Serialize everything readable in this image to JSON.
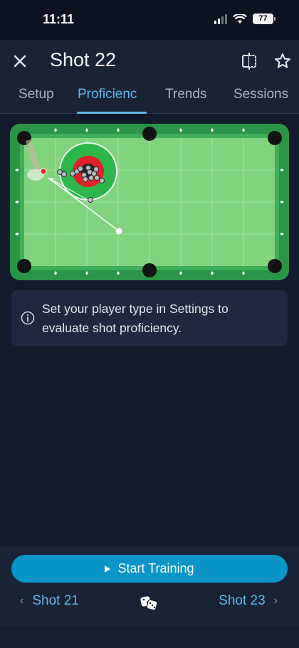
{
  "status": {
    "time": "11:11",
    "battery": "77"
  },
  "header": {
    "title": "Shot 22"
  },
  "tabs": [
    "Setup",
    "Proficienc",
    "Trends",
    "Sessions"
  ],
  "info": {
    "text": "Set your player type in Settings to evaluate shot proficiency."
  },
  "footer": {
    "start_label": "Start Training",
    "prev_label": "Shot 21",
    "next_label": "Shot 23"
  },
  "icons": {
    "close": "close-icon",
    "compare": "compare-icon",
    "star": "star-icon",
    "info": "info-icon",
    "dice": "dice-icon",
    "play": "play-icon"
  },
  "colors": {
    "accent": "#5fb7e8",
    "button": "#0a95c9",
    "felt": "#7fd17a",
    "rail": "#2e9b4a",
    "target_ring": "#e0202a"
  }
}
